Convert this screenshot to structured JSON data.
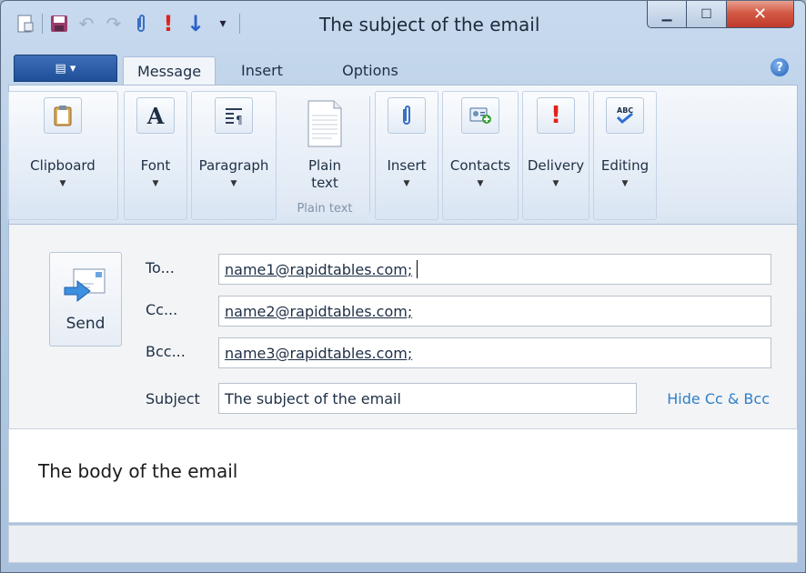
{
  "window": {
    "title": "The subject of the email"
  },
  "quick_access": {
    "icons": [
      "new-window-icon",
      "save-icon",
      "undo-icon",
      "redo-icon",
      "attach-icon",
      "high-importance-icon",
      "low-importance-icon",
      "customize-icon"
    ]
  },
  "tabs": {
    "file_menu": "▤ ▾",
    "items": [
      {
        "label": "Message",
        "active": true
      },
      {
        "label": "Insert",
        "active": false
      },
      {
        "label": "Options",
        "active": false
      }
    ],
    "help": "?"
  },
  "ribbon": {
    "groups": [
      {
        "label": "Clipboard",
        "icon": "clipboard-icon"
      },
      {
        "label": "Font",
        "icon": "font-icon"
      },
      {
        "label": "Paragraph",
        "icon": "paragraph-icon"
      },
      {
        "label": "Plain\ntext",
        "line1": "Plain",
        "line2": "text",
        "sub": "Plain text",
        "icon": "plain-text-icon"
      },
      {
        "label": "Insert",
        "icon": "paperclip-icon"
      },
      {
        "label": "Contacts",
        "icon": "contacts-icon"
      },
      {
        "label": "Delivery",
        "icon": "exclamation-icon"
      },
      {
        "label": "Editing",
        "icon": "spellcheck-icon"
      }
    ]
  },
  "compose": {
    "send_label": "Send",
    "to_label": "To...",
    "to_value": "name1@rapidtables.com;",
    "cc_label": "Cc...",
    "cc_value": "name2@rapidtables.com;",
    "bcc_label": "Bcc...",
    "bcc_value": "name3@rapidtables.com;",
    "subject_label": "Subject",
    "subject_value": "The subject of the email",
    "hide_cc_bcc": "Hide Cc & Bcc",
    "body": "The body of the email"
  },
  "colors": {
    "accent": "#2f7fc7",
    "close": "#c0392b",
    "file_button": "#1f4f98"
  }
}
